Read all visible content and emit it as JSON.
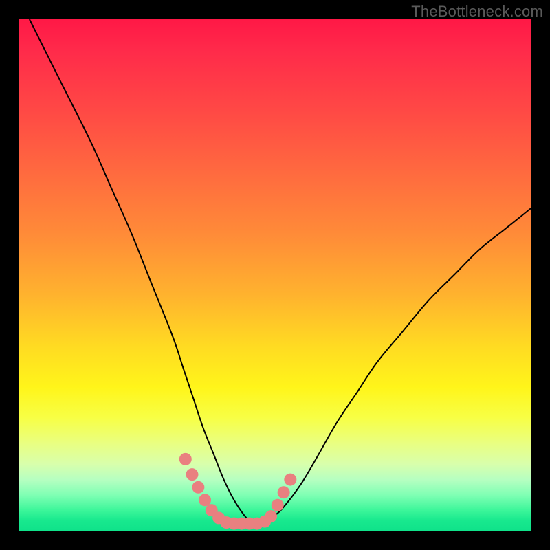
{
  "watermark": "TheBottleneck.com",
  "chart_data": {
    "type": "line",
    "title": "",
    "xlabel": "",
    "ylabel": "",
    "xlim": [
      0,
      100
    ],
    "ylim": [
      0,
      100
    ],
    "note": "No axes, ticks, or numeric labels are visible. X and Y curve values are normalized 0–100 of the plotting region.",
    "series": [
      {
        "name": "left-curve",
        "x": [
          2,
          8,
          14,
          18,
          22,
          26,
          30,
          32,
          34,
          36,
          38,
          40,
          42,
          44,
          45
        ],
        "y": [
          100,
          88,
          76,
          67,
          58,
          48,
          38,
          32,
          26,
          20,
          15,
          10,
          6,
          3,
          2
        ]
      },
      {
        "name": "right-curve",
        "x": [
          45,
          48,
          50,
          52,
          55,
          58,
          62,
          66,
          70,
          75,
          80,
          85,
          90,
          95,
          100
        ],
        "y": [
          2,
          2,
          3,
          5,
          9,
          14,
          21,
          27,
          33,
          39,
          45,
          50,
          55,
          59,
          63
        ]
      }
    ],
    "markers": [
      {
        "x": 32.5,
        "y": 14
      },
      {
        "x": 33.8,
        "y": 11
      },
      {
        "x": 35.0,
        "y": 8.5
      },
      {
        "x": 36.3,
        "y": 6
      },
      {
        "x": 37.6,
        "y": 4
      },
      {
        "x": 39.0,
        "y": 2.5
      },
      {
        "x": 40.5,
        "y": 1.6
      },
      {
        "x": 42.0,
        "y": 1.4
      },
      {
        "x": 43.5,
        "y": 1.4
      },
      {
        "x": 45.0,
        "y": 1.4
      },
      {
        "x": 46.5,
        "y": 1.4
      },
      {
        "x": 48.0,
        "y": 1.8
      },
      {
        "x": 49.2,
        "y": 2.8
      },
      {
        "x": 50.5,
        "y": 5
      },
      {
        "x": 51.7,
        "y": 7.5
      },
      {
        "x": 53.0,
        "y": 10
      }
    ],
    "gradient_meaning": "background hue encodes magnitude: red high, through orange/yellow, to green low"
  }
}
